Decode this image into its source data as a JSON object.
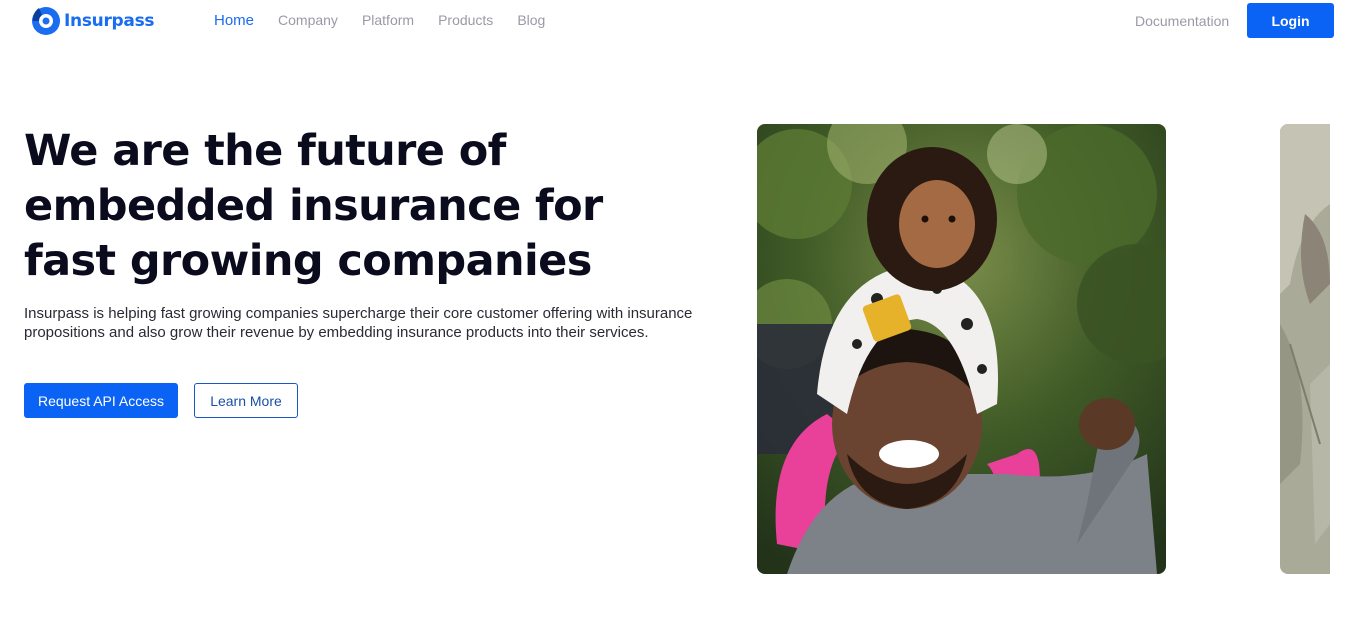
{
  "brand": {
    "name": "Insurpass",
    "color": "#1a6cf0",
    "logo_icon": "insurpass-logo-icon"
  },
  "nav": {
    "links": [
      {
        "label": "Home",
        "active": true
      },
      {
        "label": "Company",
        "active": false
      },
      {
        "label": "Platform",
        "active": false
      },
      {
        "label": "Products",
        "active": false
      },
      {
        "label": "Blog",
        "active": false
      }
    ],
    "documentation": "Documentation",
    "login": "Login"
  },
  "hero": {
    "title_lines": [
      "We are the future of",
      "embedded insurance for",
      "fast growing companies"
    ],
    "description": "Insurpass is helping fast growing companies supercharge their core customer offering with insurance propositions and also grow their revenue by embedding insurance products into their services.",
    "primary_button": "Request API Access",
    "secondary_button": "Learn More"
  },
  "images": {
    "main": "photo of a smiling man carrying a young girl on his shoulders outdoors",
    "side": "partial photo of a person in a grey-green shirt"
  },
  "colors": {
    "accent": "#0b63f6",
    "text": "#0b0b1e",
    "muted": "#9a9aa6"
  }
}
